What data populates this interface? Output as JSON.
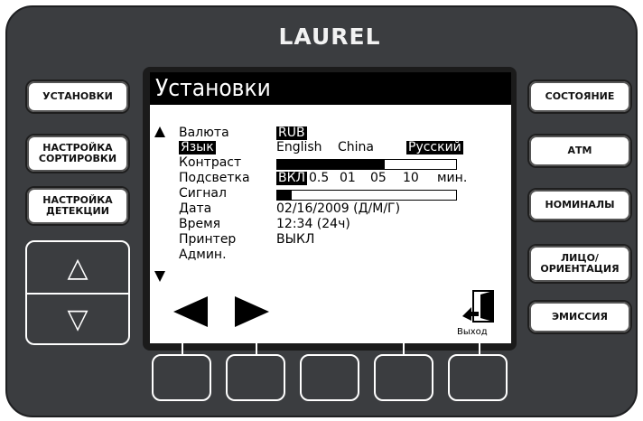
{
  "brand": "LAUREL",
  "left_buttons": [
    {
      "label": "УСТАНОВКИ"
    },
    {
      "label": "НАСТРОЙКА\nСОРТИРОВКИ"
    },
    {
      "label": "НАСТРОЙКА\nДЕТЕКЦИИ"
    }
  ],
  "right_buttons": [
    {
      "label": "СОСТОЯНИЕ"
    },
    {
      "label": "АТМ"
    },
    {
      "label": "НОМИНАЛЫ"
    },
    {
      "label": "ЛИЦО/\nОРИЕНТАЦИЯ"
    },
    {
      "label": "ЭМИССИЯ"
    }
  ],
  "up_down": {
    "up": "△",
    "down": "▽"
  },
  "screen": {
    "title": "Установки",
    "rows": [
      {
        "label": "Валюта",
        "value": "RUB"
      },
      {
        "label": "Язык",
        "options": [
          "English",
          "China",
          "Русский"
        ],
        "selected": "Русский"
      },
      {
        "label": "Контраст",
        "level": 0.6
      },
      {
        "label": "Подсветка",
        "selected": "ВКЛ",
        "options": [
          "0.5",
          "01",
          "05",
          "10"
        ],
        "unit": "мин."
      },
      {
        "label": "Сигнал",
        "level": 0.08
      },
      {
        "label": "Дата",
        "value": "02/16/2009 (Д/М/Г)"
      },
      {
        "label": "Время",
        "value": "12:34 (24ч)"
      },
      {
        "label": "Принтер",
        "value": "ВЫКЛ"
      },
      {
        "label": "Админ."
      }
    ],
    "exit_label": "Выход"
  }
}
